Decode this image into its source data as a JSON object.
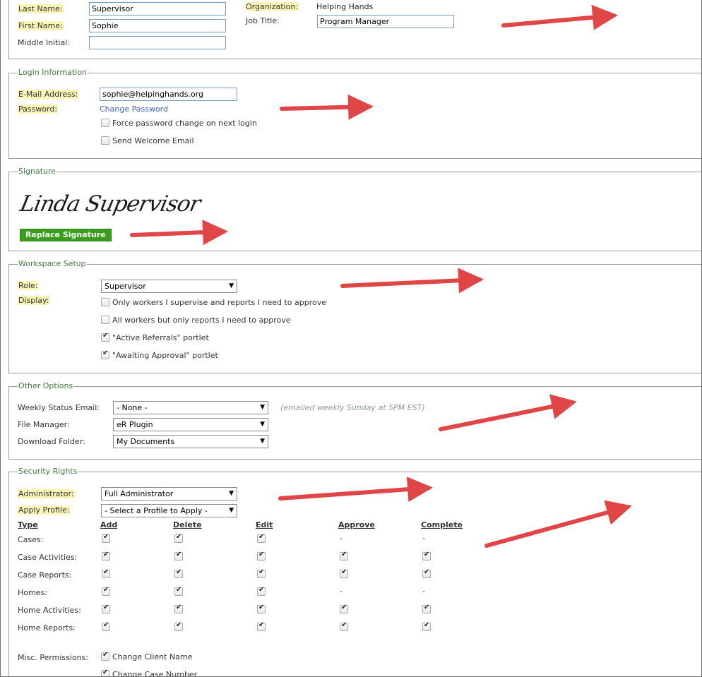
{
  "identity": {
    "last_name_label": "Last Name:",
    "last_name_value": "Supervisor",
    "first_name_label": "First Name:",
    "first_name_value": "Sophie",
    "middle_initial_label": "Middle Initial:",
    "middle_initial_value": "",
    "organization_label": "Organization:",
    "organization_value": "Helping Hands",
    "job_title_label": "Job Title:",
    "job_title_value": "Program Manager"
  },
  "login": {
    "legend": "Login Information",
    "email_label": "E-Mail Address:",
    "email_value": "sophie@helpinghands.org",
    "password_label": "Password:",
    "change_password": "Change Password",
    "force_change_label": "Force password change on next login",
    "force_change_checked": false,
    "welcome_label": "Send Welcome Email",
    "welcome_checked": false
  },
  "signature": {
    "legend": "Signature",
    "signature_text": "Linda Supervisor",
    "replace_button": "Replace Signature"
  },
  "workspace": {
    "legend": "Workspace Setup",
    "role_label": "Role:",
    "role_value": "Supervisor",
    "display_label": "Display:",
    "options": [
      {
        "label": "Only workers I supervise and reports I need to approve",
        "checked": false
      },
      {
        "label": "All workers but only reports I need to approve",
        "checked": false
      },
      {
        "label": "\"Active Referrals\" portlet",
        "checked": true
      },
      {
        "label": "\"Awaiting Approval\" portlet",
        "checked": true
      }
    ]
  },
  "other": {
    "legend": "Other Options",
    "weekly_label": "Weekly Status Email:",
    "weekly_value": "- None -",
    "weekly_hint": "(emailed weekly Sunday at 5PM EST)",
    "file_manager_label": "File Manager:",
    "file_manager_value": "eR Plugin",
    "download_label": "Download Folder:",
    "download_value": "My Documents"
  },
  "security": {
    "legend": "Security Rights",
    "admin_label": "Administrator:",
    "admin_value": "Full Administrator",
    "profile_label": "Apply Profile:",
    "profile_value": "- Select a Profile to Apply -",
    "headers": [
      "Type",
      "Add",
      "Delete",
      "Edit",
      "Approve",
      "Complete"
    ],
    "rows": [
      {
        "type": "Cases:",
        "cells": [
          "check",
          "check",
          "check",
          "-",
          "-"
        ]
      },
      {
        "type": "Case Activities:",
        "cells": [
          "check",
          "check",
          "check",
          "check",
          "check"
        ]
      },
      {
        "type": "Case Reports:",
        "cells": [
          "check",
          "check",
          "check",
          "check",
          "check"
        ]
      },
      {
        "type": "Homes:",
        "cells": [
          "check",
          "check",
          "check",
          "-",
          "-"
        ]
      },
      {
        "type": "Home Activities:",
        "cells": [
          "check",
          "check",
          "check",
          "check",
          "check"
        ]
      },
      {
        "type": "Home Reports:",
        "cells": [
          "check",
          "check",
          "check",
          "check",
          "check"
        ]
      }
    ],
    "misc_label": "Misc. Permissions:",
    "misc_items": [
      {
        "label": "Change Client Name",
        "checked": true
      },
      {
        "label": "Change Case Number",
        "checked": true
      }
    ]
  },
  "colors": {
    "required_bg": "#fbf6b7",
    "legend_text": "#3c7a3c",
    "link": "#3f5fbf",
    "button_green": "#3a9d1c",
    "annotation_arrow": "#e04646"
  },
  "annotations": {
    "icon": "red-arrow-icon",
    "count": 7
  }
}
